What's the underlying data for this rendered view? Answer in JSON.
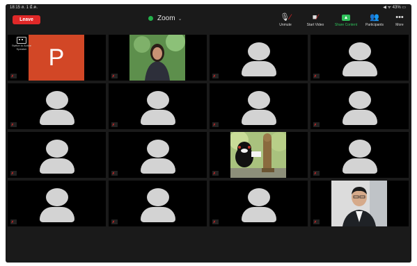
{
  "status_bar": {
    "time": "18:15 ส. 1 มี.ค.",
    "system": "◀ ᯤ 43% ▭"
  },
  "header": {
    "leave_label": "Leave",
    "meeting_title": "Zoom",
    "controls": [
      {
        "icon": "microphone-muted-icon",
        "label": "Unmute"
      },
      {
        "icon": "video-camera-off-icon",
        "label": "Start Video"
      },
      {
        "icon": "share-screen-icon",
        "label": "Share Content"
      },
      {
        "icon": "participants-icon",
        "label": "Participants"
      },
      {
        "icon": "more-icon",
        "label": "More"
      }
    ]
  },
  "switch_view": {
    "label": "Switch to Active Speaker"
  },
  "tiles": [
    {
      "type": "video",
      "content": "presentation-logo",
      "letter": "P",
      "name": ""
    },
    {
      "type": "video",
      "content": "person",
      "name": ""
    },
    {
      "type": "avatar",
      "name": ""
    },
    {
      "type": "avatar",
      "name": ""
    },
    {
      "type": "avatar",
      "name": ""
    },
    {
      "type": "avatar",
      "name": ""
    },
    {
      "type": "avatar",
      "name": ""
    },
    {
      "type": "avatar",
      "name": ""
    },
    {
      "type": "avatar",
      "name": ""
    },
    {
      "type": "avatar",
      "name": ""
    },
    {
      "type": "video",
      "content": "bear-mascot-statue",
      "name": ""
    },
    {
      "type": "avatar",
      "name": ""
    },
    {
      "type": "avatar",
      "name": ""
    },
    {
      "type": "avatar",
      "name": ""
    },
    {
      "type": "avatar",
      "name": ""
    },
    {
      "type": "video",
      "content": "person",
      "name": ""
    }
  ]
}
